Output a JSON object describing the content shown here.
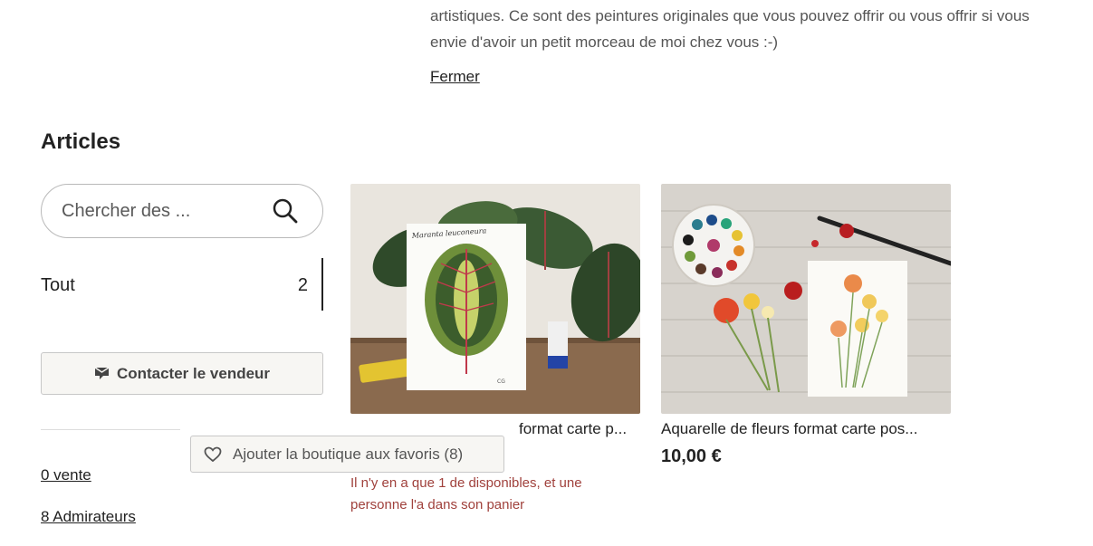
{
  "about": {
    "line1": "artistiques. Ce sont des peintures originales que vous pouvez offrir ou vous offrir si vous",
    "line2": "envie d'avoir un petit morceau de moi chez vous :-)",
    "close_label": "Fermer"
  },
  "articles": {
    "title": "Articles",
    "search": {
      "placeholder": "Chercher des ...",
      "icon": "search-icon"
    },
    "categories": [
      {
        "label": "Tout",
        "count": "2"
      }
    ]
  },
  "contact": {
    "label": "Contacter le vendeur",
    "icon": "message-icon"
  },
  "favorite": {
    "label": "Ajouter la boutique aux favoris (8)",
    "icon": "heart-icon"
  },
  "stats": {
    "sales": "0 vente",
    "admirers": "8 Admirateurs"
  },
  "listings": [
    {
      "title": "Maranta leuconeura, aquarelle format carte postale",
      "visible_title": "format carte p...",
      "note": "Il n'y en a que 1 de disponibles, et une personne l'a dans son panier",
      "image_text": "Maranta leuconeura"
    },
    {
      "title": "Aquarelle de fleurs format carte pos...",
      "price": "10,00 €"
    }
  ],
  "colors": {
    "accent": "#222222",
    "note": "#a0413c",
    "button_bg": "#f7f6f3"
  }
}
